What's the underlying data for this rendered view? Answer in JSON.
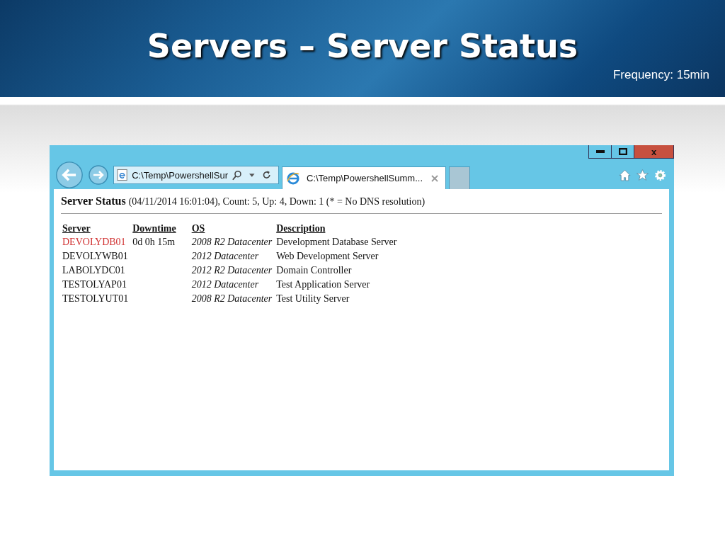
{
  "slide": {
    "title": "Servers – Server Status",
    "subtitle": "Frequency: 15min"
  },
  "window_controls": [
    {
      "kind": "minimize"
    },
    {
      "kind": "maximize"
    },
    {
      "kind": "close",
      "label": "x"
    }
  ],
  "address_bar": {
    "value": "C:\\Temp\\PowershellSur"
  },
  "tabs": [
    {
      "label": "C:\\Temp\\PowershellSumm...",
      "selected": true
    }
  ],
  "page": {
    "heading": "Server Status",
    "summary": "(04/11/2014 16:01:04), Count: 5, Up: 4, Down: 1 (* = No DNS resolution)",
    "columns": [
      "Server",
      "Downtime",
      "OS",
      "Description"
    ],
    "rows": [
      {
        "server": "DEVOLYDB01",
        "down": true,
        "downtime": "0d 0h 15m",
        "os": "2008 R2 Datacenter",
        "description": "Development Database Server"
      },
      {
        "server": "DEVOLYWB01",
        "down": false,
        "os": "2012 Datacenter",
        "description": "Web Development Server"
      },
      {
        "server": "LABOLYDC01",
        "down": false,
        "os": "2012 R2 Datacenter",
        "description": "Domain Controller"
      },
      {
        "server": "TESTOLYAP01",
        "down": false,
        "os": "2012 Datacenter",
        "description": "Test Application Server"
      },
      {
        "server": "TESTOLYUT01",
        "down": false,
        "os": "2008 R2 Datacenter",
        "description": "Test Utility Server"
      }
    ]
  }
}
